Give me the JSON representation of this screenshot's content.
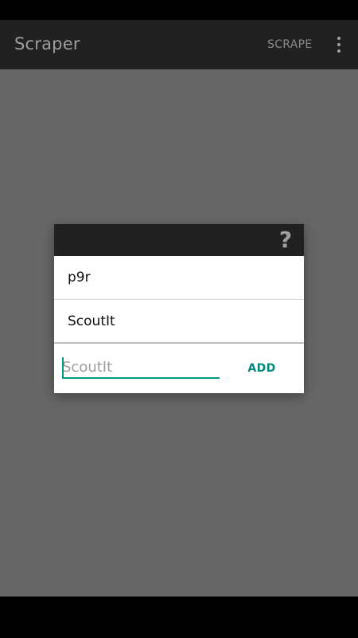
{
  "app_bar": {
    "title": "Scraper",
    "scrape_label": "SCRAPE",
    "overflow_icon": "more-vert-icon"
  },
  "dialog": {
    "help_icon": "?",
    "items": [
      {
        "label": "p9r"
      },
      {
        "label": "ScoutIt"
      }
    ],
    "input": {
      "value": "",
      "placeholder": "ScoutIt"
    },
    "add_label": "ADD"
  },
  "colors": {
    "app_bar": "#212121",
    "scrim": "#666666",
    "accent": "#009688"
  }
}
